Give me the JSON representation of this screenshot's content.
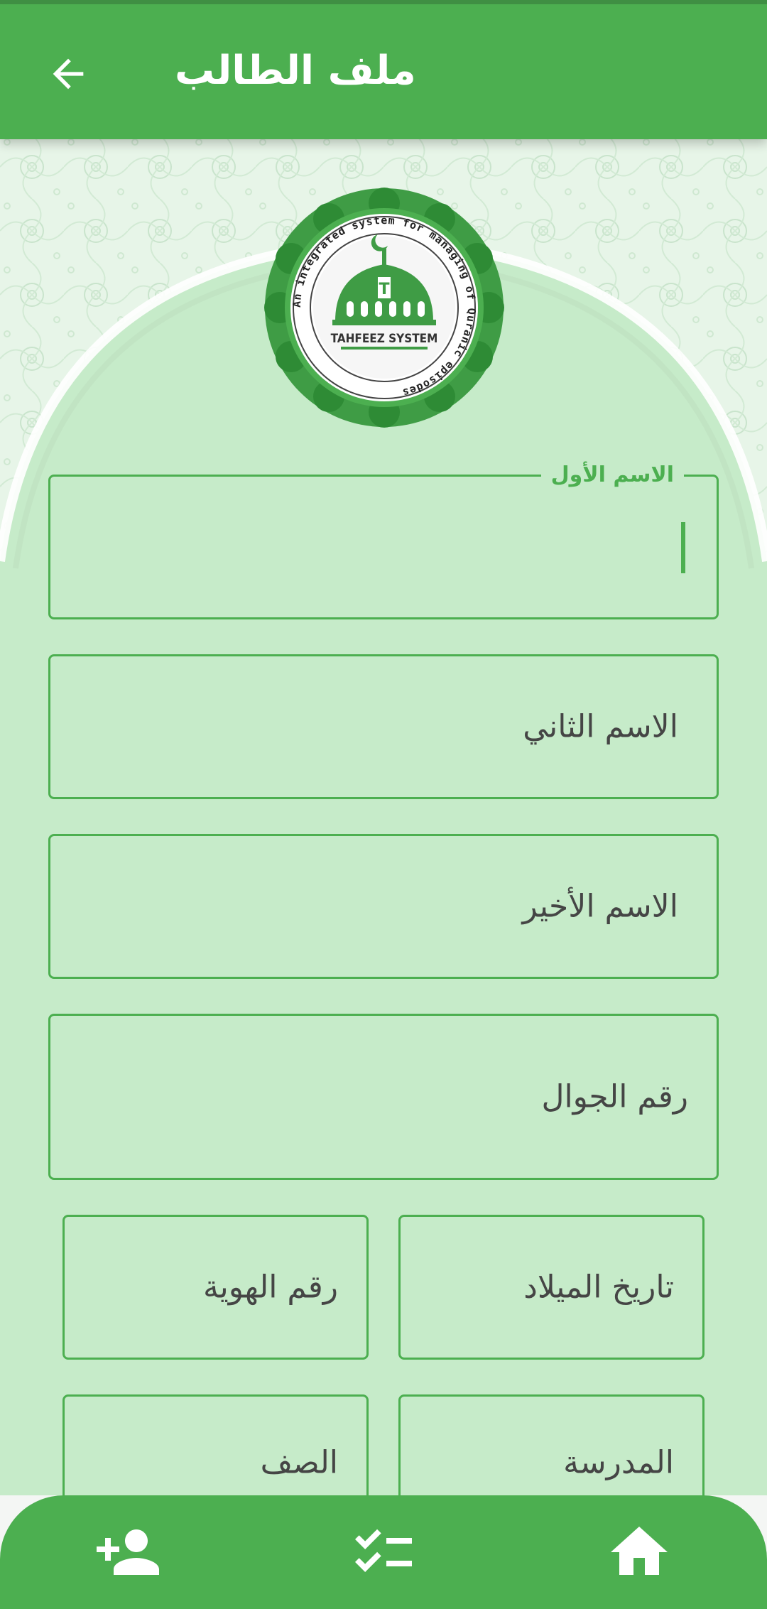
{
  "header": {
    "title": "ملف الطالب",
    "back_icon": "arrow-back-icon"
  },
  "logo": {
    "ring_text": "An integrated system for managing of Quranic episodes",
    "name": "TAHFEEZ SYSTEM"
  },
  "form": {
    "first_name": {
      "label": "الاسم الأول",
      "value": ""
    },
    "second_name": {
      "label": "الاسم الثاني"
    },
    "last_name": {
      "label": "الاسم الأخير"
    },
    "mobile": {
      "label": "رقم الجوال"
    },
    "birth_date": {
      "label": "تاريخ الميلاد"
    },
    "id_number": {
      "label": "رقم الهوية"
    },
    "school": {
      "label": "المدرسة"
    },
    "grade": {
      "label": "الصف"
    }
  },
  "bottom_nav": {
    "items": [
      {
        "icon": "add-person-icon"
      },
      {
        "icon": "checklist-icon"
      },
      {
        "icon": "home-icon"
      }
    ]
  },
  "colors": {
    "primary": "#4caf50",
    "background": "#c6ebc9",
    "text": "#454545"
  }
}
